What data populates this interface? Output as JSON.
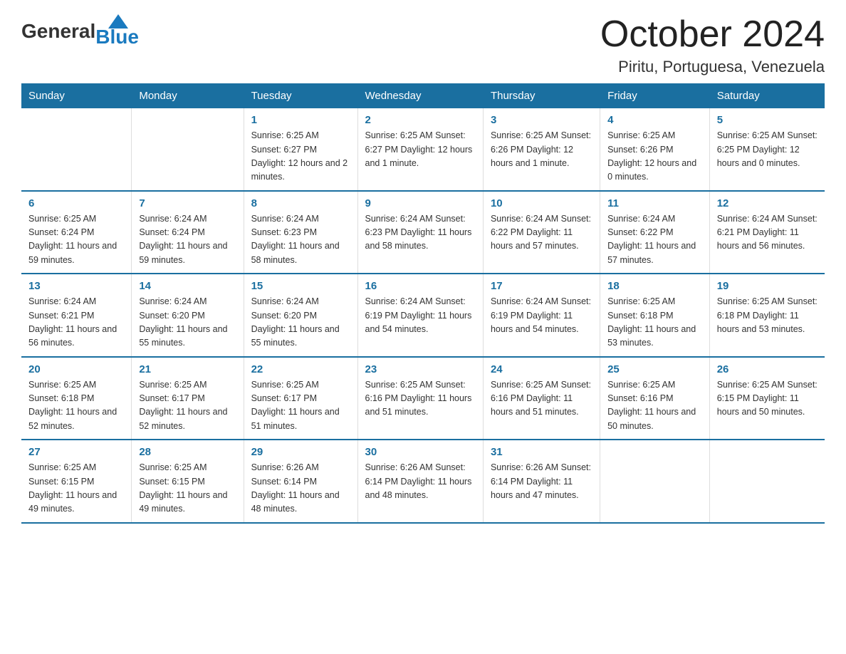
{
  "header": {
    "logo_general": "General",
    "logo_blue": "Blue",
    "month": "October 2024",
    "location": "Piritu, Portuguesa, Venezuela"
  },
  "calendar": {
    "days_of_week": [
      "Sunday",
      "Monday",
      "Tuesday",
      "Wednesday",
      "Thursday",
      "Friday",
      "Saturday"
    ],
    "weeks": [
      [
        {
          "day": "",
          "info": ""
        },
        {
          "day": "",
          "info": ""
        },
        {
          "day": "1",
          "info": "Sunrise: 6:25 AM\nSunset: 6:27 PM\nDaylight: 12 hours\nand 2 minutes."
        },
        {
          "day": "2",
          "info": "Sunrise: 6:25 AM\nSunset: 6:27 PM\nDaylight: 12 hours\nand 1 minute."
        },
        {
          "day": "3",
          "info": "Sunrise: 6:25 AM\nSunset: 6:26 PM\nDaylight: 12 hours\nand 1 minute."
        },
        {
          "day": "4",
          "info": "Sunrise: 6:25 AM\nSunset: 6:26 PM\nDaylight: 12 hours\nand 0 minutes."
        },
        {
          "day": "5",
          "info": "Sunrise: 6:25 AM\nSunset: 6:25 PM\nDaylight: 12 hours\nand 0 minutes."
        }
      ],
      [
        {
          "day": "6",
          "info": "Sunrise: 6:25 AM\nSunset: 6:24 PM\nDaylight: 11 hours\nand 59 minutes."
        },
        {
          "day": "7",
          "info": "Sunrise: 6:24 AM\nSunset: 6:24 PM\nDaylight: 11 hours\nand 59 minutes."
        },
        {
          "day": "8",
          "info": "Sunrise: 6:24 AM\nSunset: 6:23 PM\nDaylight: 11 hours\nand 58 minutes."
        },
        {
          "day": "9",
          "info": "Sunrise: 6:24 AM\nSunset: 6:23 PM\nDaylight: 11 hours\nand 58 minutes."
        },
        {
          "day": "10",
          "info": "Sunrise: 6:24 AM\nSunset: 6:22 PM\nDaylight: 11 hours\nand 57 minutes."
        },
        {
          "day": "11",
          "info": "Sunrise: 6:24 AM\nSunset: 6:22 PM\nDaylight: 11 hours\nand 57 minutes."
        },
        {
          "day": "12",
          "info": "Sunrise: 6:24 AM\nSunset: 6:21 PM\nDaylight: 11 hours\nand 56 minutes."
        }
      ],
      [
        {
          "day": "13",
          "info": "Sunrise: 6:24 AM\nSunset: 6:21 PM\nDaylight: 11 hours\nand 56 minutes."
        },
        {
          "day": "14",
          "info": "Sunrise: 6:24 AM\nSunset: 6:20 PM\nDaylight: 11 hours\nand 55 minutes."
        },
        {
          "day": "15",
          "info": "Sunrise: 6:24 AM\nSunset: 6:20 PM\nDaylight: 11 hours\nand 55 minutes."
        },
        {
          "day": "16",
          "info": "Sunrise: 6:24 AM\nSunset: 6:19 PM\nDaylight: 11 hours\nand 54 minutes."
        },
        {
          "day": "17",
          "info": "Sunrise: 6:24 AM\nSunset: 6:19 PM\nDaylight: 11 hours\nand 54 minutes."
        },
        {
          "day": "18",
          "info": "Sunrise: 6:25 AM\nSunset: 6:18 PM\nDaylight: 11 hours\nand 53 minutes."
        },
        {
          "day": "19",
          "info": "Sunrise: 6:25 AM\nSunset: 6:18 PM\nDaylight: 11 hours\nand 53 minutes."
        }
      ],
      [
        {
          "day": "20",
          "info": "Sunrise: 6:25 AM\nSunset: 6:18 PM\nDaylight: 11 hours\nand 52 minutes."
        },
        {
          "day": "21",
          "info": "Sunrise: 6:25 AM\nSunset: 6:17 PM\nDaylight: 11 hours\nand 52 minutes."
        },
        {
          "day": "22",
          "info": "Sunrise: 6:25 AM\nSunset: 6:17 PM\nDaylight: 11 hours\nand 51 minutes."
        },
        {
          "day": "23",
          "info": "Sunrise: 6:25 AM\nSunset: 6:16 PM\nDaylight: 11 hours\nand 51 minutes."
        },
        {
          "day": "24",
          "info": "Sunrise: 6:25 AM\nSunset: 6:16 PM\nDaylight: 11 hours\nand 51 minutes."
        },
        {
          "day": "25",
          "info": "Sunrise: 6:25 AM\nSunset: 6:16 PM\nDaylight: 11 hours\nand 50 minutes."
        },
        {
          "day": "26",
          "info": "Sunrise: 6:25 AM\nSunset: 6:15 PM\nDaylight: 11 hours\nand 50 minutes."
        }
      ],
      [
        {
          "day": "27",
          "info": "Sunrise: 6:25 AM\nSunset: 6:15 PM\nDaylight: 11 hours\nand 49 minutes."
        },
        {
          "day": "28",
          "info": "Sunrise: 6:25 AM\nSunset: 6:15 PM\nDaylight: 11 hours\nand 49 minutes."
        },
        {
          "day": "29",
          "info": "Sunrise: 6:26 AM\nSunset: 6:14 PM\nDaylight: 11 hours\nand 48 minutes."
        },
        {
          "day": "30",
          "info": "Sunrise: 6:26 AM\nSunset: 6:14 PM\nDaylight: 11 hours\nand 48 minutes."
        },
        {
          "day": "31",
          "info": "Sunrise: 6:26 AM\nSunset: 6:14 PM\nDaylight: 11 hours\nand 47 minutes."
        },
        {
          "day": "",
          "info": ""
        },
        {
          "day": "",
          "info": ""
        }
      ]
    ]
  }
}
